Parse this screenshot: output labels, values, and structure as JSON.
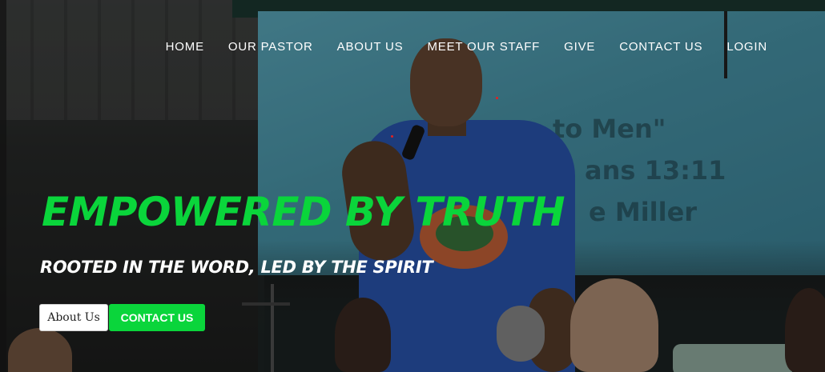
{
  "nav": {
    "items": [
      {
        "label": "HOME"
      },
      {
        "label": "OUR PASTOR"
      },
      {
        "label": "ABOUT US"
      },
      {
        "label": "MEET OUR STAFF"
      },
      {
        "label": "GIVE"
      },
      {
        "label": "CONTACT US"
      },
      {
        "label": "LOGIN"
      }
    ]
  },
  "hero": {
    "headline": "EMPOWERED BY TRUTH",
    "subhead": "ROOTED IN THE WORD, LED BY THE SPIRIT",
    "buttons": {
      "about_label": "About Us",
      "contact_label": "CONTACT US"
    },
    "projection_text": [
      "to Men\"",
      "ans 13:11",
      "e Miller"
    ]
  },
  "colors": {
    "accent_green": "#0ad53b",
    "nav_text": "#ffffff"
  }
}
